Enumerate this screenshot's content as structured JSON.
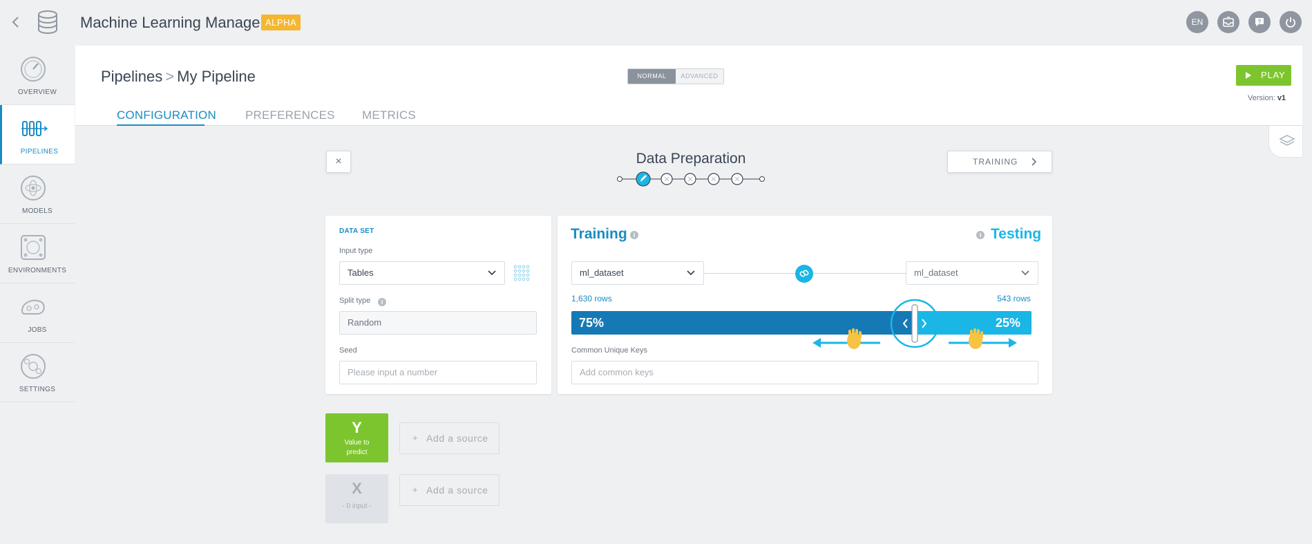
{
  "app": {
    "title": "Machine Learning Manager",
    "badge": "ALPHA"
  },
  "header_buttons": {
    "language": "EN"
  },
  "sidebar": {
    "items": [
      {
        "label": "OVERVIEW"
      },
      {
        "label": "PIPELINES"
      },
      {
        "label": "MODELS"
      },
      {
        "label": "ENVIRONMENTS"
      },
      {
        "label": "JOBS"
      },
      {
        "label": "SETTINGS"
      }
    ],
    "active_index": 1
  },
  "breadcrumb": {
    "root": "Pipelines",
    "separator": ">",
    "current": "My Pipeline"
  },
  "mode_toggle": {
    "normal": "NORMAL",
    "advanced": "ADVANCED",
    "selected": "NORMAL"
  },
  "play_button": {
    "label": "PLAY"
  },
  "version": {
    "label": "Version:",
    "value": "v1"
  },
  "tabs": [
    {
      "label": "CONFIGURATION",
      "active": true
    },
    {
      "label": "PREFERENCES",
      "active": false
    },
    {
      "label": "METRICS",
      "active": false
    }
  ],
  "wizard": {
    "close_label": "×",
    "step_title": "Data Preparation",
    "next_label": "TRAINING",
    "steps_total": 5,
    "current_step": 1
  },
  "dataset_card": {
    "section_title": "DATA SET",
    "input_type_label": "Input type",
    "input_type_value": "Tables",
    "split_type_label": "Split type",
    "split_type_value": "Random",
    "seed_label": "Seed",
    "seed_placeholder": "Please input a number"
  },
  "split_card": {
    "training_title": "Training",
    "testing_title": "Testing",
    "training_dataset": "ml_dataset",
    "testing_dataset": "ml_dataset",
    "training_rows": "1,630 rows",
    "testing_rows": "543 rows",
    "training_pct_label": "75%",
    "testing_pct_label": "25%",
    "training_fraction": 0.75,
    "keys_label": "Common Unique Keys",
    "keys_placeholder": "Add common keys"
  },
  "sources": {
    "y": {
      "letter": "Y",
      "caption": "Value to predict",
      "add_label": "Add a source"
    },
    "x": {
      "letter": "X",
      "caption": "- 0 input -",
      "add_label": "Add a source"
    }
  },
  "colors": {
    "accent": "#1a8bc4",
    "testing": "#19b6e6",
    "training_bar": "#1579b5",
    "play": "#7dc52e",
    "alpha": "#f5b731"
  }
}
